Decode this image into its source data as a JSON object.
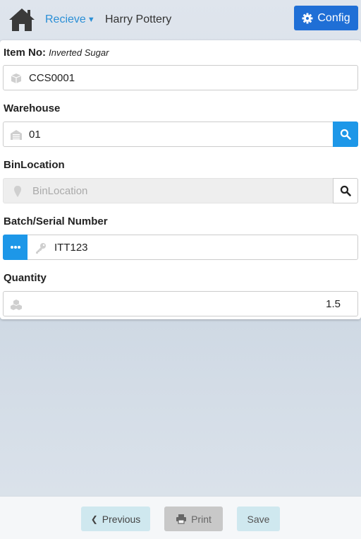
{
  "header": {
    "menu_label": "Recieve",
    "company": "Harry Pottery",
    "config_label": "Config"
  },
  "item": {
    "label": "Item No:",
    "description": "Inverted Sugar",
    "value": "CCS0001"
  },
  "warehouse": {
    "label": "Warehouse",
    "value": "01"
  },
  "bin": {
    "label": "BinLocation",
    "placeholder": "BinLocation"
  },
  "batch": {
    "label": "Batch/Serial Number",
    "value": "ITT123"
  },
  "quantity": {
    "label": "Quantity",
    "value": "1.5"
  },
  "footer": {
    "previous_label": "Previous",
    "print_label": "Print",
    "save_label": "Save"
  },
  "colors": {
    "accent": "#1d97e8",
    "config": "#1f6fd6",
    "link": "#2b8fd6"
  }
}
